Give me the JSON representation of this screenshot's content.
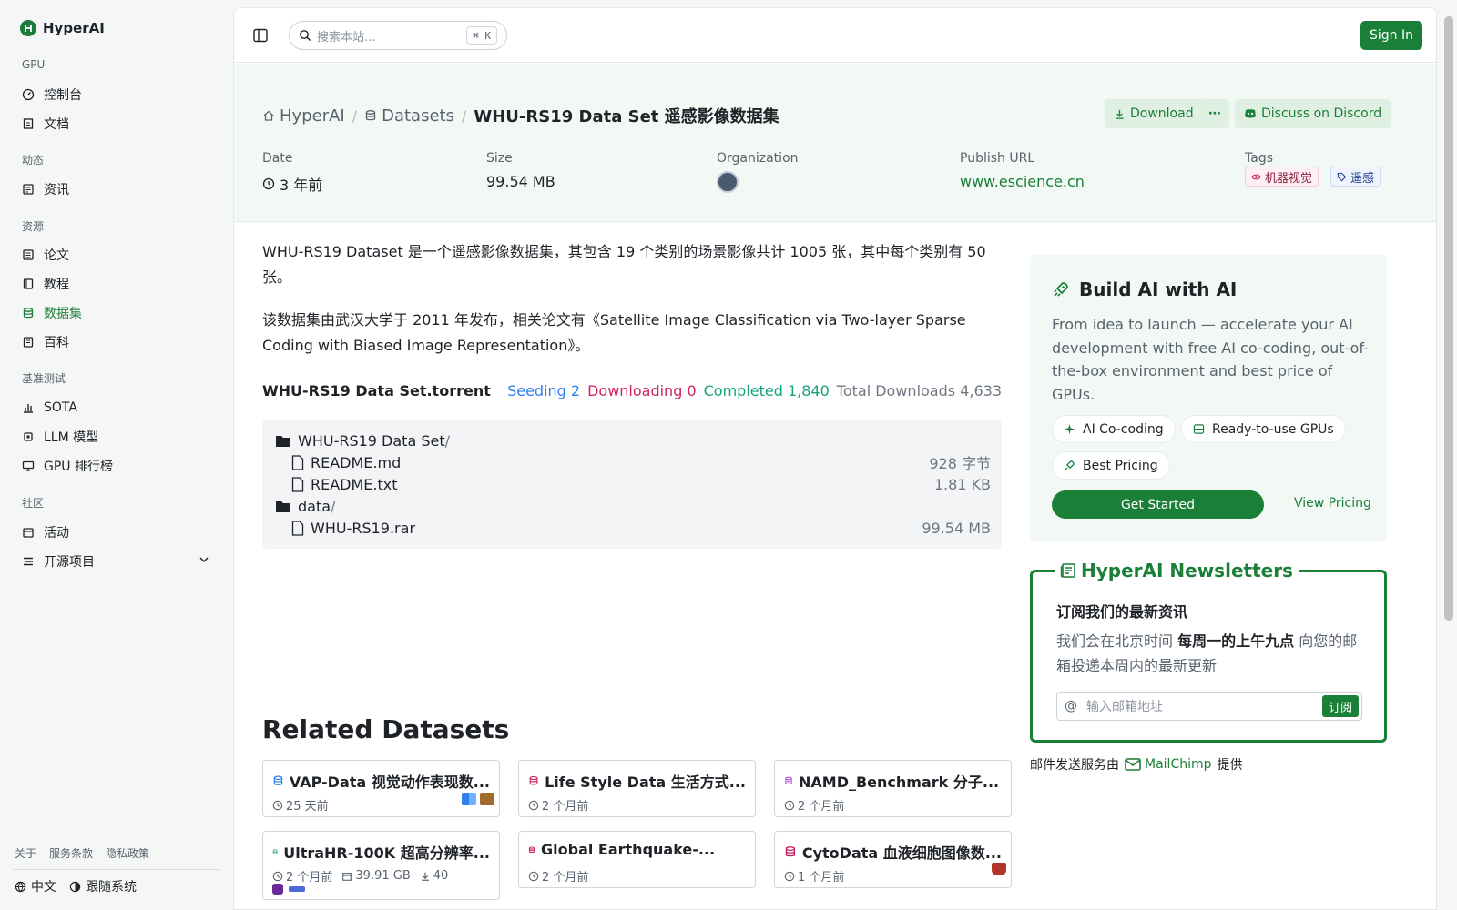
{
  "brand": {
    "name": "HyperAI"
  },
  "sidebar": {
    "sections": [
      {
        "label": "GPU",
        "items": [
          {
            "label": "控制台",
            "icon": "gauge-icon"
          },
          {
            "label": "文档",
            "icon": "doc-icon"
          }
        ]
      },
      {
        "label": "动态",
        "items": [
          {
            "label": "资讯",
            "icon": "news-icon"
          }
        ]
      },
      {
        "label": "资源",
        "items": [
          {
            "label": "论文",
            "icon": "paper-icon"
          },
          {
            "label": "教程",
            "icon": "book-icon"
          },
          {
            "label": "数据集",
            "icon": "database-icon",
            "active": true
          },
          {
            "label": "百科",
            "icon": "wiki-icon"
          }
        ]
      },
      {
        "label": "基准测试",
        "items": [
          {
            "label": "SOTA",
            "icon": "bar-chart-icon"
          },
          {
            "label": "LLM 模型",
            "icon": "chip-icon"
          },
          {
            "label": "GPU 排行榜",
            "icon": "monitor-icon"
          }
        ]
      },
      {
        "label": "社区",
        "items": [
          {
            "label": "活动",
            "icon": "event-icon"
          },
          {
            "label": "开源项目",
            "icon": "list-icon"
          }
        ]
      }
    ],
    "footer_links": [
      "关于",
      "服务条款",
      "隐私政策"
    ],
    "language": "中文",
    "theme": "跟随系统"
  },
  "topbar": {
    "search_placeholder": "搜索本站...",
    "shortcut": "⌘ K",
    "signin": "Sign In"
  },
  "header": {
    "breadcrumb": {
      "home": "HyperAI",
      "section": "Datasets",
      "current": "WHU-RS19 Data Set 遥感影像数据集"
    },
    "download": "Download",
    "more": "⋯",
    "discord": "Discuss on Discord",
    "meta": {
      "date_label": "Date",
      "date_value": "3 年前",
      "size_label": "Size",
      "size_value": "99.54 MB",
      "org_label": "Organization",
      "url_label": "Publish URL",
      "url_value": "www.escience.cn",
      "tags_label": "Tags",
      "tags": [
        "机器视觉",
        "遥感"
      ]
    }
  },
  "content": {
    "para1": "WHU-RS19 Dataset 是一个遥感影像数据集，其包含 19 个类别的场景影像共计 1005 张，其中每个类别有 50 张。",
    "para2": "该数据集由武汉大学于 2011 年发布，相关论文有《Satellite Image Classification via Two-layer Sparse Coding with Biased Image Representation》。",
    "torrent": {
      "title": "WHU-RS19 Data Set.torrent",
      "seeding": "Seeding 2",
      "downloading": "Downloading 0",
      "completed": "Completed 1,840",
      "total": "Total Downloads 4,633"
    },
    "files": [
      {
        "name": "WHU-RS19 Data Set",
        "type": "folder",
        "size": ""
      },
      {
        "name": "README.md",
        "type": "file",
        "size": "928 字节"
      },
      {
        "name": "README.txt",
        "type": "file",
        "size": "1.81 KB"
      },
      {
        "name": "data",
        "type": "folder",
        "size": ""
      },
      {
        "name": "WHU-RS19.rar",
        "type": "file",
        "size": "99.54 MB"
      }
    ],
    "related_title": "Related Datasets",
    "related": [
      {
        "title": "VAP-Data 视觉动作表现数...",
        "date": "25 天前",
        "color": "#2f80ed"
      },
      {
        "title": "Life Style Data 生活方式...",
        "date": "2 个月前",
        "color": "#d3245a"
      },
      {
        "title": "NAMD_Benchmark 分子...",
        "date": "2 个月前",
        "color": "#b05bd6"
      },
      {
        "title": "UltraHR-100K 超高分辨率...",
        "date": "2 个月前",
        "size": "39.91 GB",
        "downloads": "40",
        "color": "#14a37f"
      },
      {
        "title": "Global Earthquake-...",
        "date": "2 个月前",
        "color": "#d3245a"
      },
      {
        "title": "CytoData 血液细胞图像数...",
        "date": "1 个月前",
        "color": "#c2185b"
      }
    ]
  },
  "build": {
    "title": "Build AI with AI",
    "desc": "From idea to launch — accelerate your AI development with free AI co-coding, out-of-the-box environment and best price of GPUs.",
    "chips": [
      "AI Co-coding",
      "Ready-to-use GPUs",
      "Best Pricing"
    ],
    "cta": "Get Started",
    "pricing": "View Pricing"
  },
  "newsletter": {
    "title": "HyperAI Newsletters",
    "heading": "订阅我们的最新资讯",
    "text_before": "我们会在北京时间 ",
    "text_bold": "每周一的上午九点",
    "text_after": " 向您的邮箱投递本周内的最新更新",
    "placeholder": "输入邮箱地址",
    "button": "订阅",
    "provider_prefix": "邮件发送服务由",
    "provider": "MailChimp",
    "provider_suffix": "提供"
  }
}
